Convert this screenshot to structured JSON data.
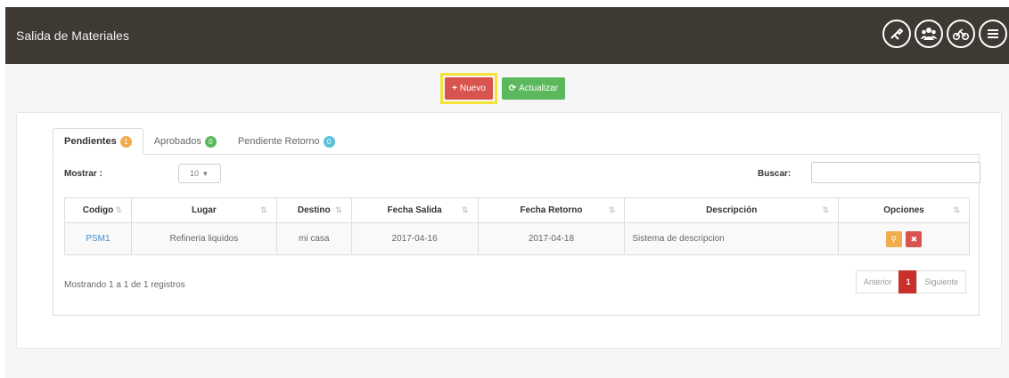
{
  "header": {
    "title": "Salida de Materiales",
    "icons": [
      "wrench-circle-icon",
      "users-circle-icon",
      "bicycle-circle-icon",
      "menu-circle-icon"
    ]
  },
  "actions": {
    "new_label": "Nuevo",
    "refresh_label": "Actualizar"
  },
  "tabs": [
    {
      "label": "Pendientes",
      "badge": "1",
      "color": "#f0ad4e"
    },
    {
      "label": "Aprobados",
      "badge": "0",
      "color": "#5cb85c"
    },
    {
      "label": "Pendiente Retorno",
      "badge": "0",
      "color": "#5bc0de"
    }
  ],
  "controls": {
    "show_label": "Mostrar :",
    "show_value": "10",
    "search_label": "Buscar:"
  },
  "table": {
    "headers": [
      "Codigo",
      "Lugar",
      "Destino",
      "Fecha Salida",
      "Fecha Retorno",
      "Descripción",
      "Opciones"
    ],
    "rows": [
      {
        "codigo": "PSM1",
        "lugar": "Refineria liquidos",
        "destino": "mi casa",
        "fecha_salida": "2017-04-16",
        "fecha_retorno": "2017-04-18",
        "descripcion": "Sistema de descripcion"
      }
    ]
  },
  "footer": {
    "info": "Mostrando 1 a 1 de 1 registros",
    "prev": "Anterior",
    "page": "1",
    "next": "Siguiente"
  },
  "colors": {
    "topbar": "#3f3934",
    "danger": "#d9534f",
    "success": "#5cb85c",
    "warning": "#f0ad4e",
    "highlight": "#f5e33b",
    "page_current": "#c9302c"
  }
}
